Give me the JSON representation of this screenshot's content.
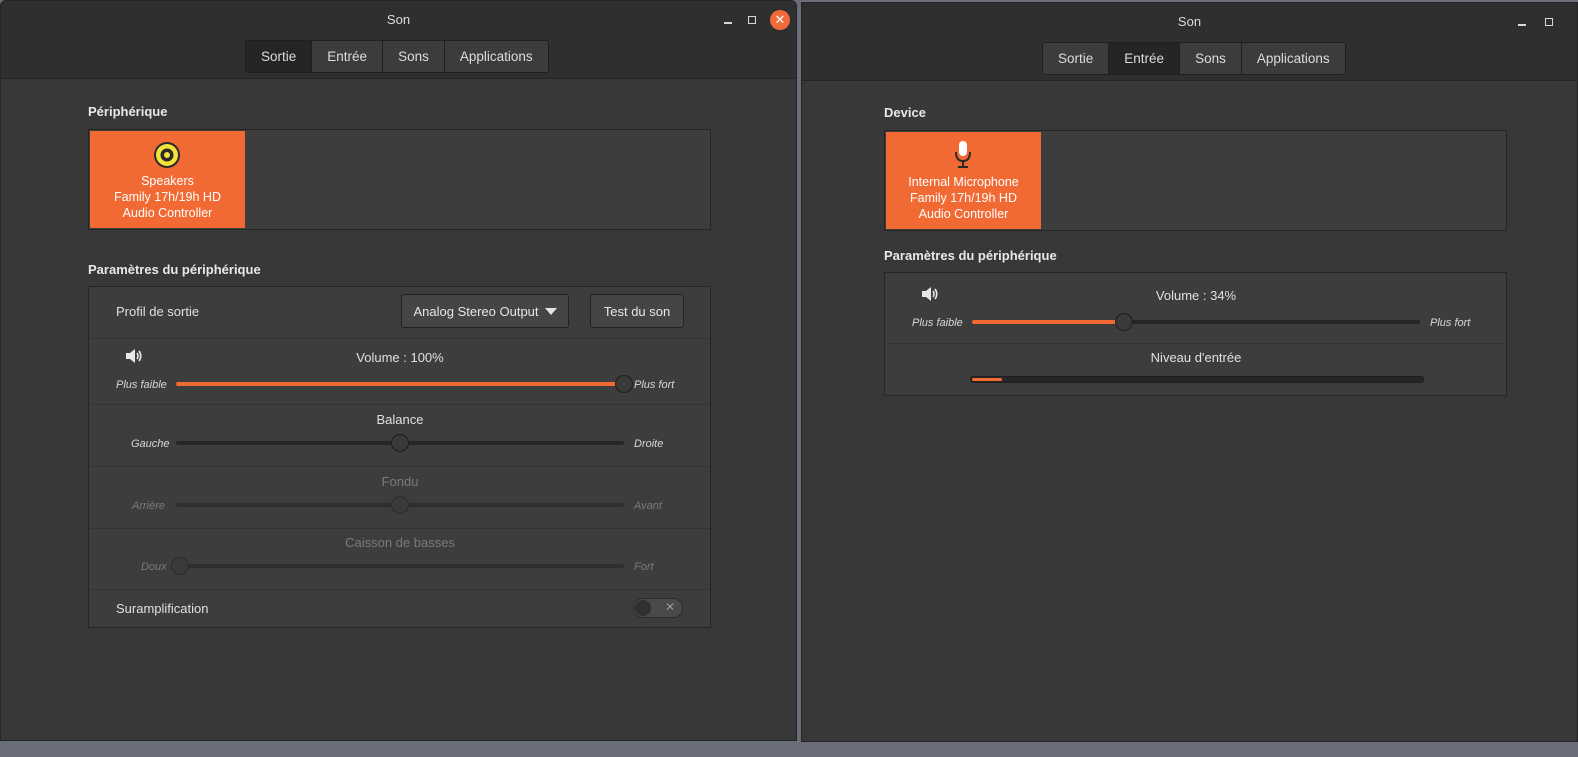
{
  "output_window": {
    "title": "Son",
    "tabs": [
      {
        "label": "Sortie",
        "active": true
      },
      {
        "label": "Entrée",
        "active": false
      },
      {
        "label": "Sons",
        "active": false
      },
      {
        "label": "Applications",
        "active": false
      }
    ],
    "device_section_label": "Périphérique",
    "device": {
      "line1": "Speakers",
      "line2": "Family 17h/19h HD",
      "line3": "Audio Controller",
      "icon": "speaker-icon"
    },
    "settings_section_label": "Paramètres du périphérique",
    "profile_label": "Profil de sortie",
    "profile_value": "Analog Stereo Output",
    "test_button": "Test du son",
    "volume_label": "Volume : 100%",
    "volume_value": 1.0,
    "volume_low": "Plus faible",
    "volume_high": "Plus fort",
    "balance_label": "Balance",
    "balance_value": 0.5,
    "balance_left": "Gauche",
    "balance_right": "Droite",
    "fade_label": "Fondu",
    "fade_value": 0.5,
    "fade_back": "Arrière",
    "fade_front": "Avant",
    "sub_label": "Caisson de basses",
    "sub_value": 0.0,
    "sub_low": "Doux",
    "sub_high": "Fort",
    "overamp_label": "Suramplification",
    "overamp_on": false
  },
  "input_window": {
    "title": "Son",
    "tabs": [
      {
        "label": "Sortie",
        "active": false
      },
      {
        "label": "Entrée",
        "active": true
      },
      {
        "label": "Sons",
        "active": false
      },
      {
        "label": "Applications",
        "active": false
      }
    ],
    "device_section_label": "Device",
    "device": {
      "line1": "Internal Microphone",
      "line2": "Family 17h/19h HD",
      "line3": "Audio Controller",
      "icon": "microphone-icon"
    },
    "settings_section_label": "Paramètres du périphérique",
    "volume_label": "Volume : 34%",
    "volume_value": 0.34,
    "volume_low": "Plus faible",
    "volume_high": "Plus fort",
    "input_level_label": "Niveau d'entrée",
    "input_level_value": 0.07
  },
  "colors": {
    "accent": "#f26a33",
    "window_bg": "#383838",
    "close_button": "#f06a3a"
  }
}
